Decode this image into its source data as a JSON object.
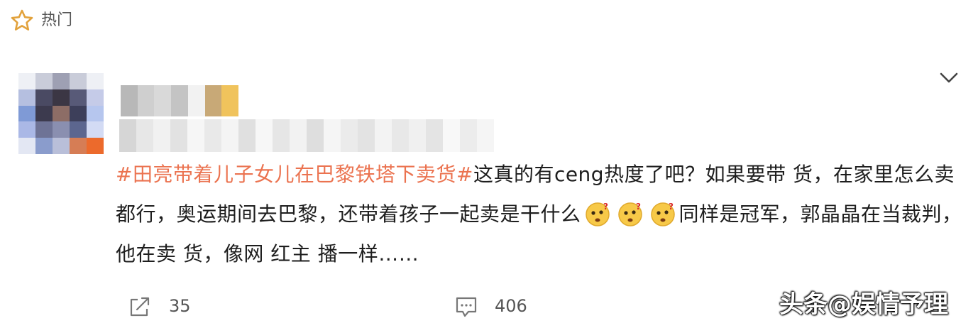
{
  "header": {
    "icon": "star-outline-icon",
    "label": "热门"
  },
  "post": {
    "topic": "#田亮带着儿子女儿在巴黎铁塔下卖货#",
    "text1": "这真的有ceng热度了吧？如果要带 货，在家里怎么卖都行，奥运期间去巴黎，还带着孩子一起卖是干什么",
    "emojis": [
      "confused-emoji-icon",
      "confused-emoji-icon",
      "confused-emoji-icon"
    ],
    "text2": "同样是冠军，郭晶晶在当裁判，他在卖 货，像网 红主 播一样……"
  },
  "actions": {
    "share_icon": "share-icon",
    "share_count": "35",
    "comment_icon": "comment-icon",
    "comment_count": "406"
  },
  "watermark": "头条@娱情予理",
  "colors": {
    "topic": "#eb7350",
    "text": "#1e1e1e",
    "muted": "#555555",
    "background": "#ffffff"
  }
}
